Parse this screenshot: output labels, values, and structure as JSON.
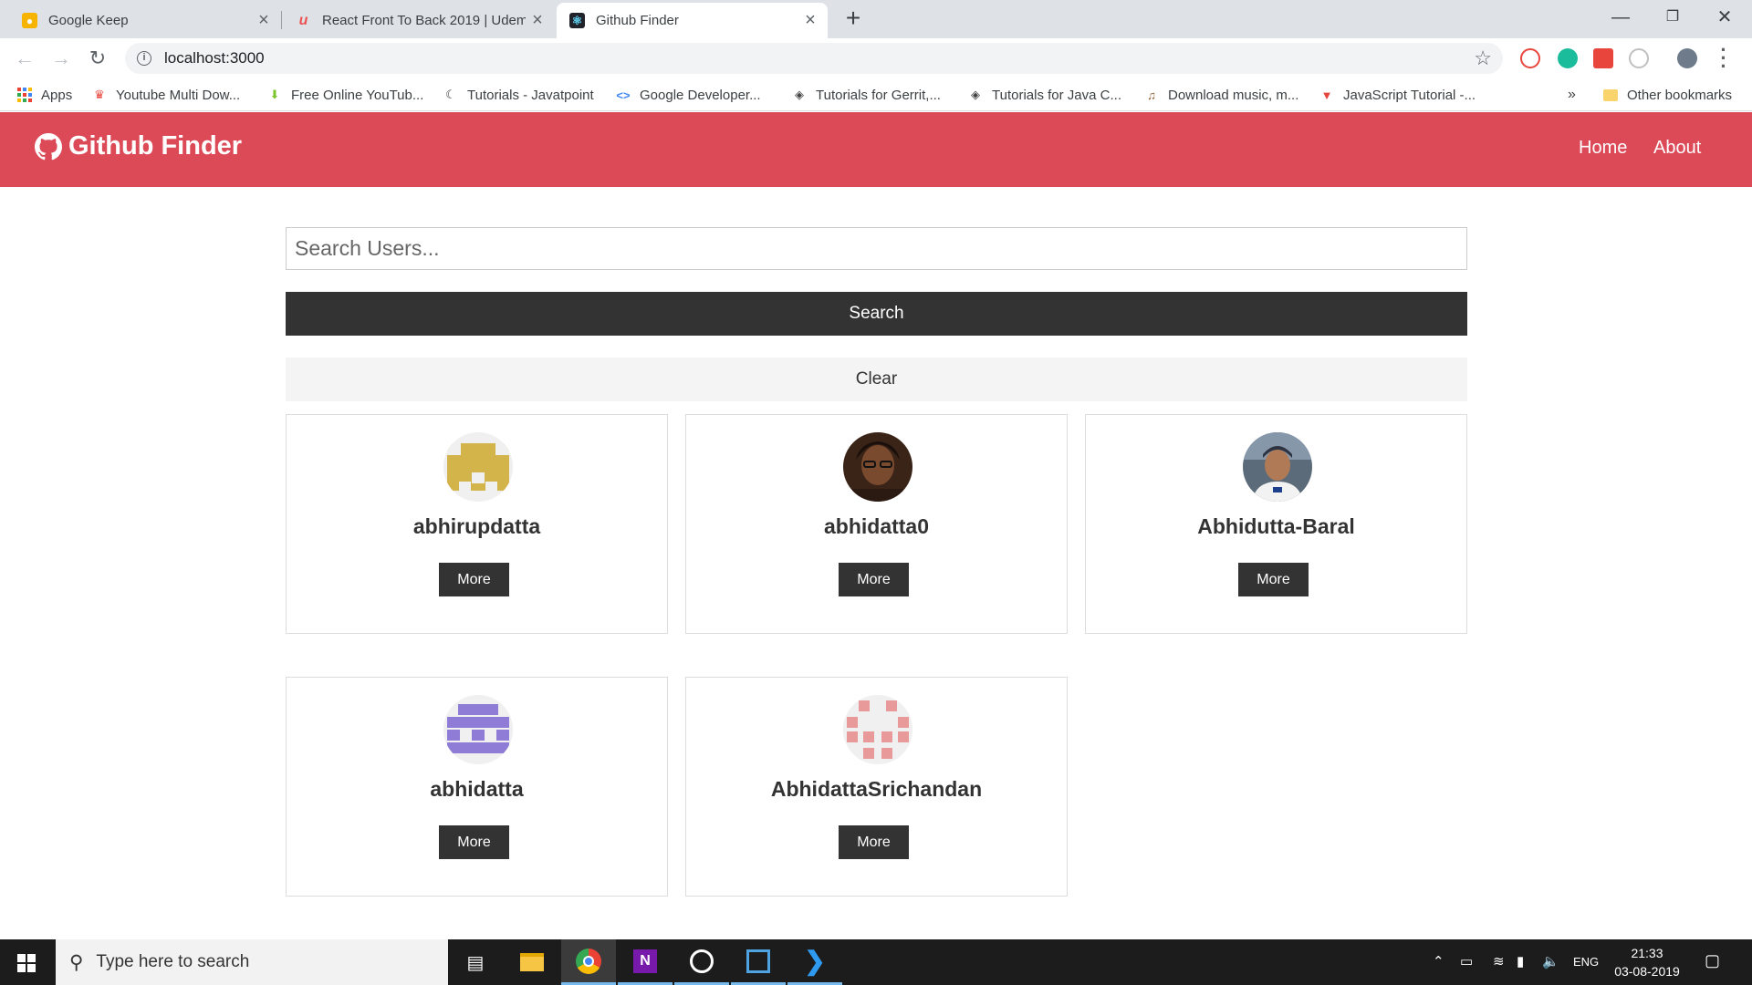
{
  "browser": {
    "tabs": [
      {
        "title": "Google Keep",
        "icon": "google-keep-icon"
      },
      {
        "title": "React Front To Back 2019 | Udemy",
        "icon": "udemy-icon"
      },
      {
        "title": "Github Finder",
        "icon": "react-icon"
      }
    ],
    "url": "localhost:3000",
    "bookmarks": [
      {
        "label": "Apps",
        "icon": "apps-grid-icon"
      },
      {
        "label": "Youtube Multi Dow...",
        "icon": "youtube-downloader-icon"
      },
      {
        "label": "Free Online YouTub...",
        "icon": "download-arrow-icon"
      },
      {
        "label": "Tutorials - Javatpoint",
        "icon": "javatpoint-icon"
      },
      {
        "label": "Google Developer...",
        "icon": "google-developers-icon"
      },
      {
        "label": "Tutorials for Gerrit,...",
        "icon": "tutorials-icon"
      },
      {
        "label": "Tutorials for Java C...",
        "icon": "tutorials-icon"
      },
      {
        "label": "Download music, m...",
        "icon": "music-icon"
      },
      {
        "label": "JavaScript Tutorial -...",
        "icon": "javascript-tutorial-icon"
      }
    ],
    "overflow": "»",
    "other_bookmarks": "Other bookmarks"
  },
  "app": {
    "brand": "Github Finder",
    "nav": {
      "home": "Home",
      "about": "About"
    },
    "search": {
      "placeholder": "Search Users...",
      "button": "Search",
      "clear": "Clear"
    },
    "more_label": "More",
    "users": [
      {
        "login": "abhirupdatta",
        "avatar": "identicon-gold"
      },
      {
        "login": "abhidatta0",
        "avatar": "photo-portrait"
      },
      {
        "login": "Abhidutta-Baral",
        "avatar": "photo-cricketer"
      },
      {
        "login": "abhidatta",
        "avatar": "identicon-purple"
      },
      {
        "login": "AbhidattaSrichandan",
        "avatar": "identicon-pink"
      }
    ]
  },
  "taskbar": {
    "search_placeholder": "Type here to search",
    "language": "ENG",
    "time": "21:33",
    "date": "03-08-2019"
  },
  "colors": {
    "navbar": "#dc4a58",
    "dark_button": "#333333",
    "light_button": "#f4f4f4"
  }
}
